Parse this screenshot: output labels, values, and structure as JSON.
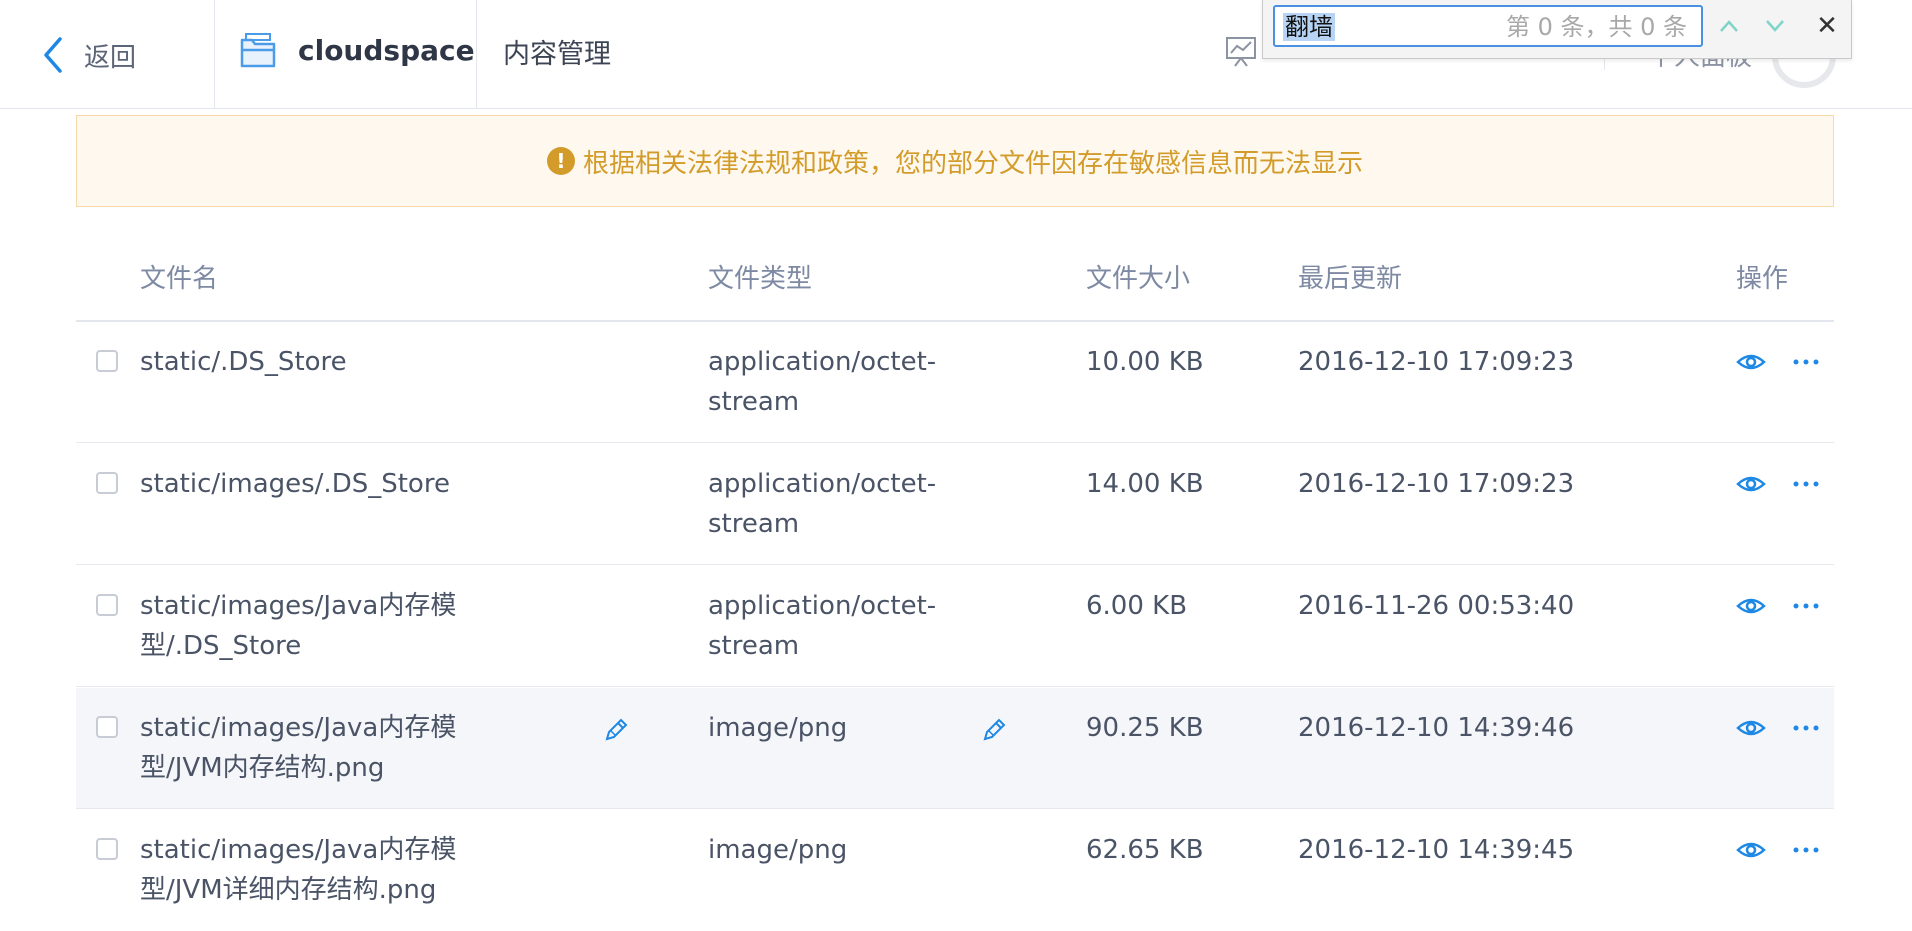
{
  "header": {
    "back_label": "返回",
    "brand_name": "cloudspace",
    "module_title": "内容管理",
    "panel_label": "个人面板"
  },
  "findbar": {
    "query": "翻墙",
    "count_text": "第 0 条，共 0 条"
  },
  "notice": {
    "text": "根据相关法律法规和政策，您的部分文件因存在敏感信息而无法显示",
    "icon": "exclamation-circle-icon",
    "color": "#d39c2a"
  },
  "table": {
    "columns": [
      "文件名",
      "文件类型",
      "文件大小",
      "最后更新",
      "操作"
    ],
    "rows": [
      {
        "name": "static/.DS_Store",
        "type": "application/octet-stream",
        "size": "10.00 KB",
        "updated": "2016-12-10 17:09:23"
      },
      {
        "name": "static/images/.DS_Store",
        "type": "application/octet-stream",
        "size": "14.00 KB",
        "updated": "2016-12-10 17:09:23"
      },
      {
        "name": "static/images/Java内存模型/.DS_Store",
        "type": "application/octet-stream",
        "size": "6.00 KB",
        "updated": "2016-11-26 00:53:40"
      },
      {
        "name": "static/images/Java内存模型/JVM内存结构.png",
        "type": "image/png",
        "size": "90.25 KB",
        "updated": "2016-12-10 14:39:46",
        "hover": true
      },
      {
        "name": "static/images/Java内存模型/JVM详细内存结构.png",
        "type": "image/png",
        "size": "62.65 KB",
        "updated": "2016-12-10 14:39:45"
      }
    ]
  },
  "colors": {
    "accent": "#1e88e5",
    "notice_bg": "#fef8ef",
    "header_text": "#7e8aa3"
  }
}
